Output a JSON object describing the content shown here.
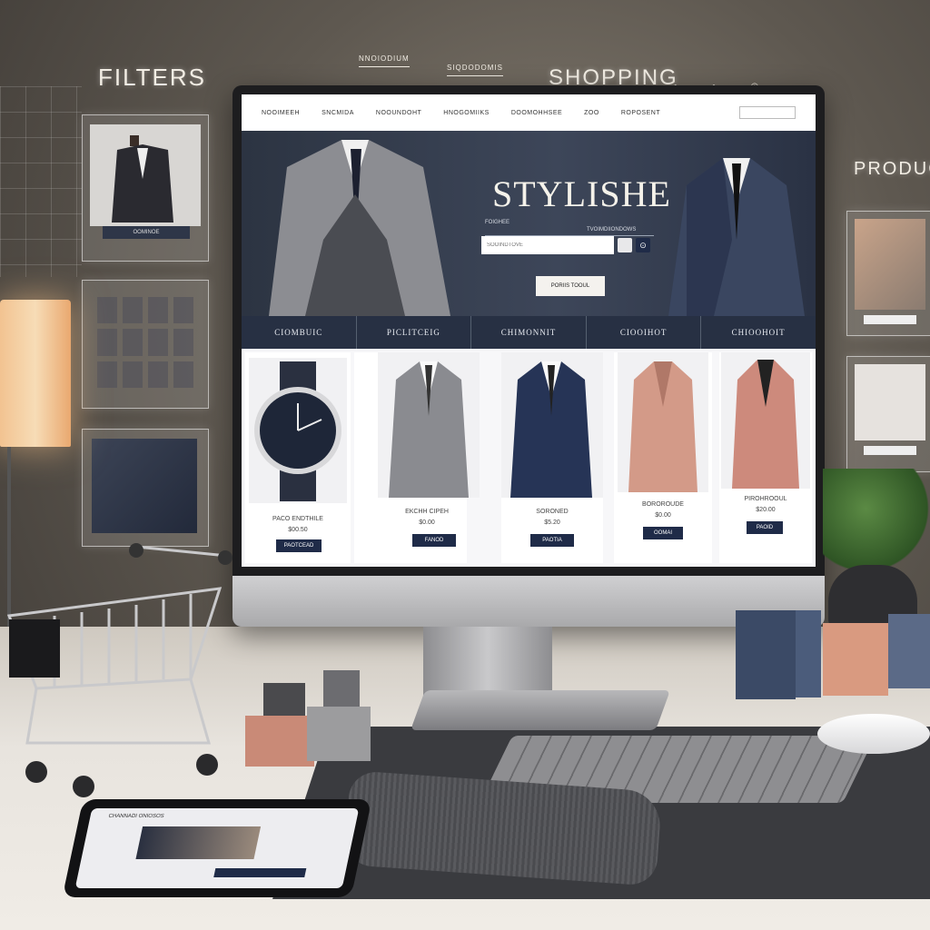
{
  "overlay": {
    "left_title": "FILTERS",
    "top_title": "SHOPPING",
    "right_title": "PRODUCT",
    "top_items": [
      "NNOIODIUM",
      "SIQDODOMIS"
    ],
    "left_panel_label": "OOMINOE"
  },
  "website": {
    "nav": [
      "NOOIMEEH",
      "SNCMIDA",
      "NOOUNDOHT",
      "HNOGOMIIKS",
      "DOOMOHHSEE",
      "ZOO",
      "ROPOSENT"
    ],
    "hero_title": "STYLISHE",
    "hero_sub_lines": [
      "FOIGHEE",
      "TVOIMDIIONDOWS"
    ],
    "search_placeholder": "SOOINDTOVE",
    "hero_button": "PORIIS TOOUL",
    "categories": [
      "CIOMBUIC",
      "PICLITCEIG",
      "CHIMONNIT",
      "CIOOIHOT",
      "CHIOOHOIT"
    ],
    "products": [
      {
        "name": "PACO ENDTHILE",
        "price": "$00.50",
        "button": "PAOTCEAD"
      },
      {
        "name": "EKCHH CIPEH",
        "price": "$0.00",
        "button": "FANOD"
      },
      {
        "name": "SORONED",
        "price": "$5.20",
        "button": "PAOTIA"
      },
      {
        "name": "BOROROUDE",
        "price": "$0.00",
        "button": "OOMAI"
      },
      {
        "name": "PIROHROOUL",
        "price": "$20.00",
        "button": "PAOID"
      }
    ]
  },
  "phone": {
    "title": "CHANNADI ONIOSOS"
  },
  "colors": {
    "navy": "#1f2b48",
    "hero": "#2c3442",
    "screen_bg": "#f4f4f6"
  }
}
